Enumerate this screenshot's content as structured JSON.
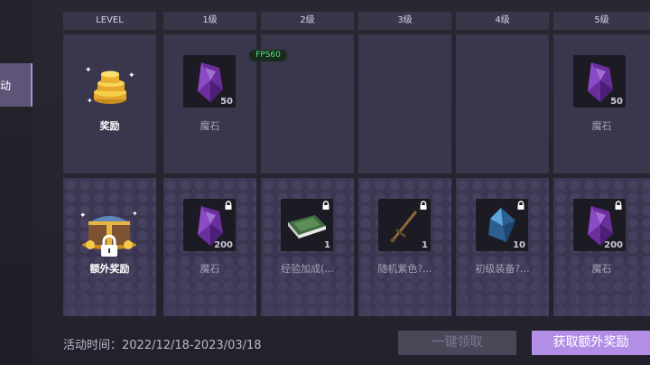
{
  "sidebar": {
    "active_tab_label": "动"
  },
  "table": {
    "headers": [
      "LEVEL",
      "1级",
      "2级",
      "3级",
      "4级",
      "5级"
    ],
    "row_labels": {
      "reward": "奖励",
      "extra_reward": "额外奖励"
    },
    "rewards": [
      {
        "name": "魔石",
        "qty": "50"
      },
      {
        "name": "",
        "qty": ""
      },
      {
        "name": "",
        "qty": ""
      },
      {
        "name": "",
        "qty": ""
      },
      {
        "name": "魔石",
        "qty": "50"
      }
    ],
    "extra_rewards": [
      {
        "name": "魔石",
        "qty": "200"
      },
      {
        "name": "经验加成(...",
        "qty": "1"
      },
      {
        "name": "随机紫色?...",
        "qty": "1"
      },
      {
        "name": "初级装备?...",
        "qty": "10"
      },
      {
        "name": "魔石",
        "qty": "200"
      }
    ]
  },
  "overlay": {
    "fps": "FPS60"
  },
  "footer": {
    "activity_time": "活动时间：2022/12/18-2023/03/18",
    "claim_all_label": "一键领取",
    "get_extra_label": "获取额外奖励"
  },
  "colors": {
    "accent": "#b38ee6",
    "panel": "#3a364b",
    "fps": "#4ee27a"
  }
}
